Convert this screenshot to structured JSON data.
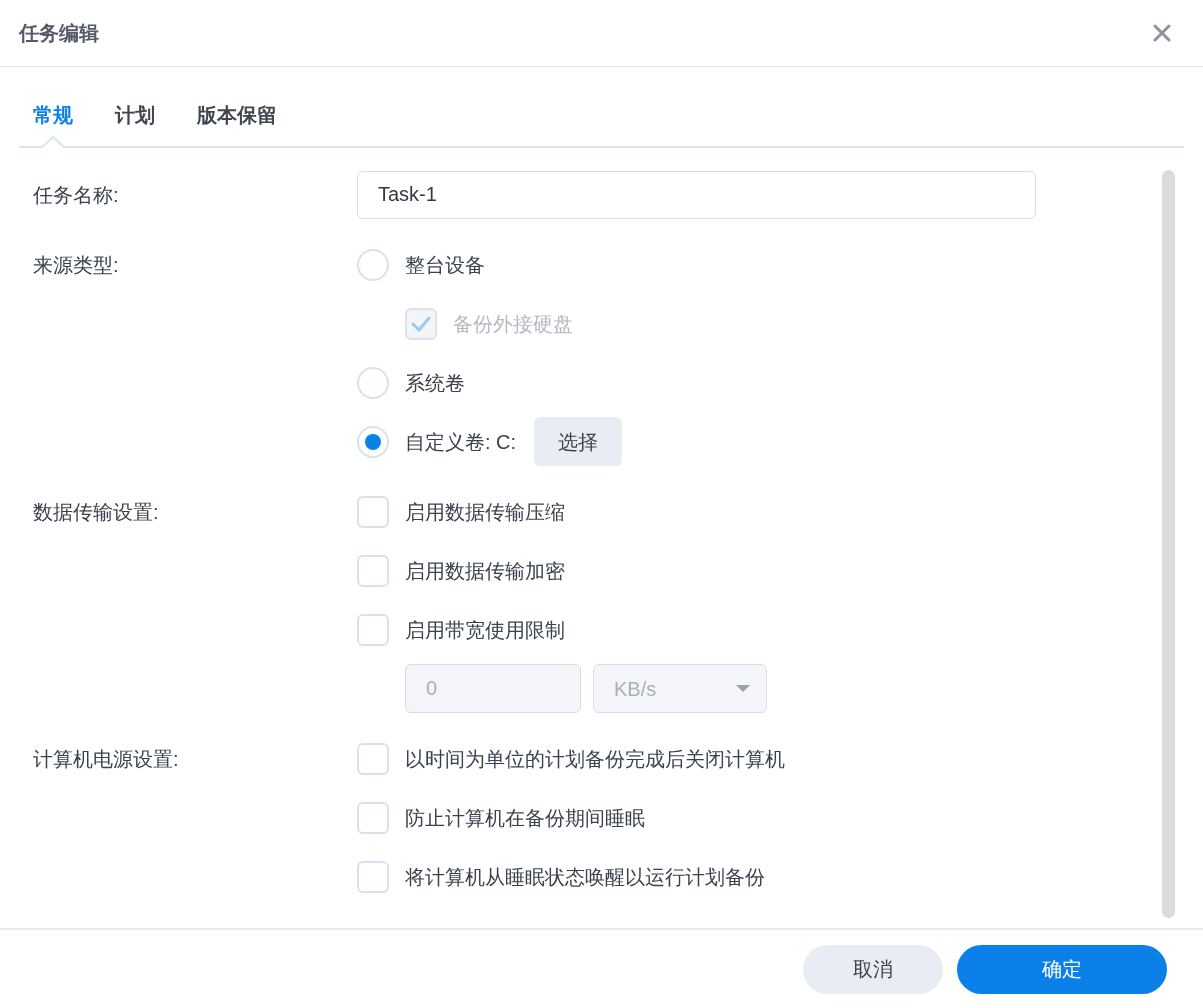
{
  "dialog": {
    "title": "任务编辑"
  },
  "tabs": [
    {
      "label": "常规",
      "selected": true
    },
    {
      "label": "计划",
      "selected": false
    },
    {
      "label": "版本保留",
      "selected": false
    }
  ],
  "form": [
    {
      "label": "任务名称:",
      "controls": [
        {
          "kind": "text",
          "value": "Task-1"
        }
      ]
    },
    {
      "label": "来源类型:",
      "controls": [
        {
          "kind": "radio",
          "label": "整台设备",
          "selected": false,
          "children": [
            {
              "kind": "checkbox",
              "label": "备份外接硬盘",
              "checked": true,
              "disabled": true
            }
          ]
        },
        {
          "kind": "radio",
          "label": "系统卷",
          "selected": false
        },
        {
          "kind": "radio",
          "label": "自定义卷: C:",
          "selected": true,
          "button": "选择"
        }
      ]
    },
    {
      "label": "数据传输设置:",
      "controls": [
        {
          "kind": "checkbox",
          "label": "启用数据传输压缩",
          "checked": false,
          "disabled": false
        },
        {
          "kind": "checkbox",
          "label": "启用数据传输加密",
          "checked": false,
          "disabled": false
        },
        {
          "kind": "checkbox",
          "label": "启用带宽使用限制",
          "checked": false,
          "disabled": false,
          "children": [
            {
              "kind": "number",
              "value": "0",
              "disabled": true
            },
            {
              "kind": "select",
              "value": "KB/s",
              "disabled": true
            }
          ]
        }
      ]
    },
    {
      "label": "计算机电源设置:",
      "controls": [
        {
          "kind": "checkbox",
          "label": "以时间为单位的计划备份完成后关闭计算机",
          "checked": false,
          "disabled": false
        },
        {
          "kind": "checkbox",
          "label": "防止计算机在备份期间睡眠",
          "checked": false,
          "disabled": false
        },
        {
          "kind": "checkbox",
          "label": "将计算机从睡眠状态唤醒以运行计划备份",
          "checked": false,
          "disabled": false
        }
      ]
    }
  ],
  "footer": {
    "buttons": [
      {
        "label": "取消",
        "kind": "secondary"
      },
      {
        "label": "确定",
        "kind": "primary"
      }
    ]
  }
}
